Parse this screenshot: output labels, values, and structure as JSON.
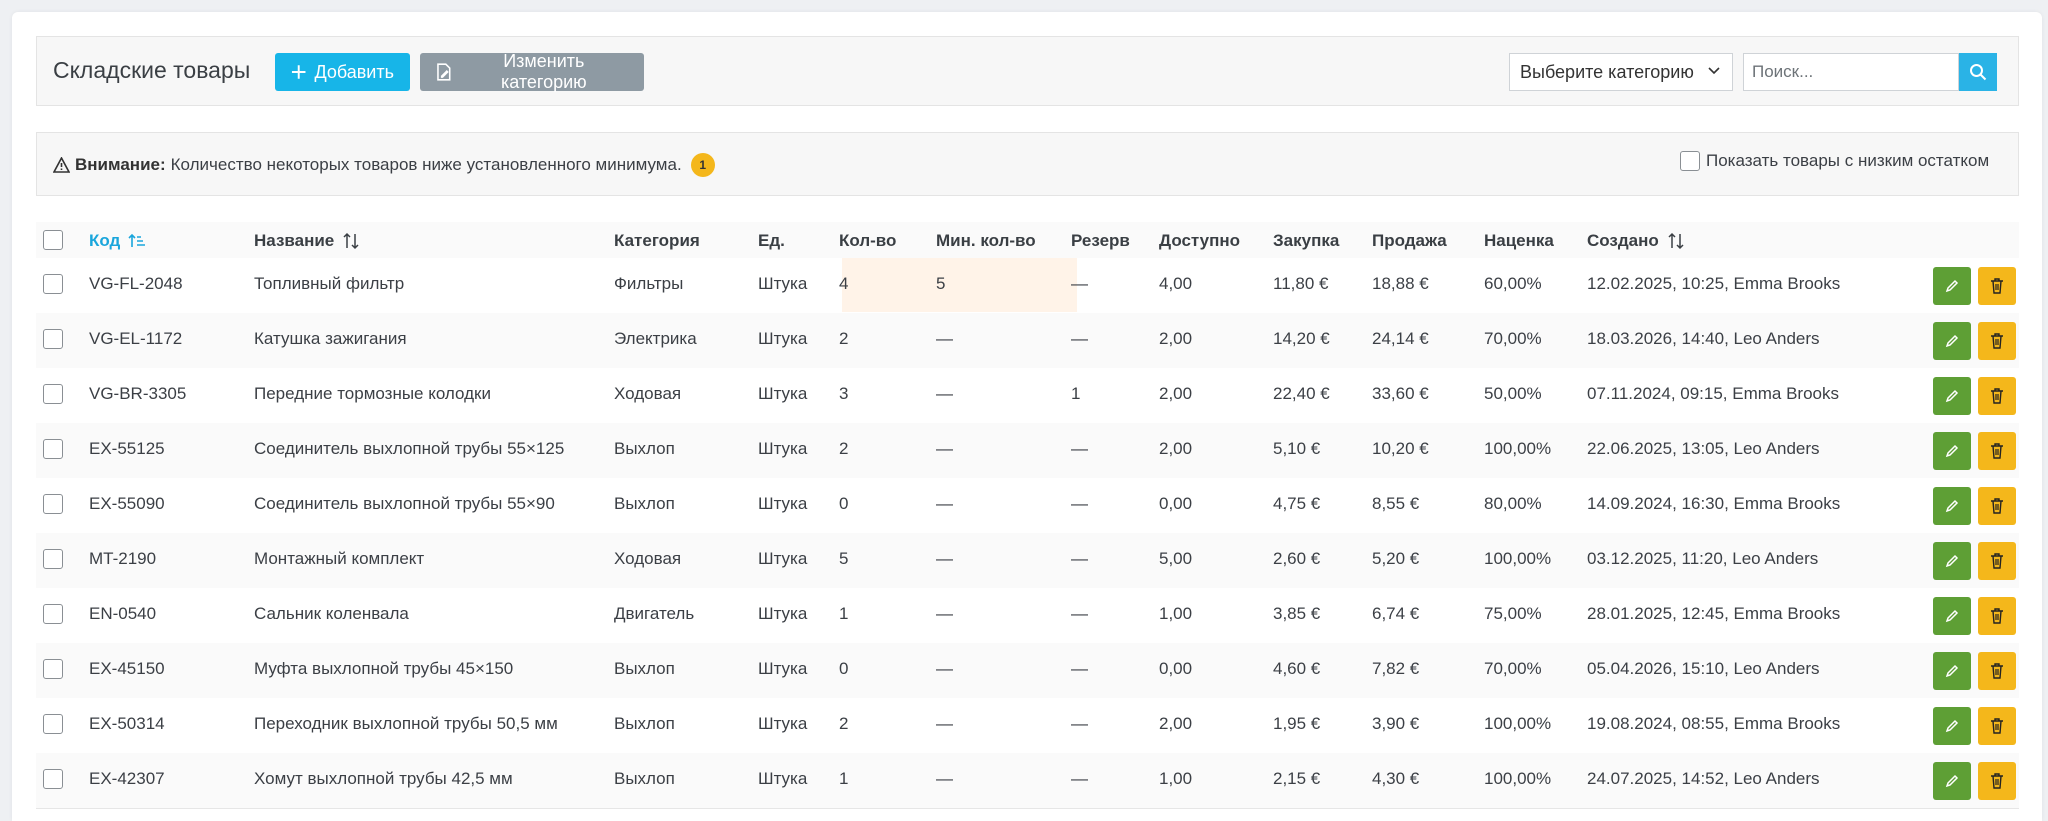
{
  "header": {
    "title": "Складские товары",
    "add_label": "Добавить",
    "change_category_label": "Изменить категорию",
    "category_select_value": "Выберите категорию",
    "search_placeholder": "Поиск..."
  },
  "alert": {
    "bold": "Внимание:",
    "message": "Количество некоторых товаров ниже установленного минимума.",
    "count": "1",
    "low_stock_label": "Показать товары с низким остатком"
  },
  "columns": {
    "code": "Код",
    "name": "Название",
    "category": "Категория",
    "unit": "Ед.",
    "qty": "Кол-во",
    "min_qty": "Мин. кол-во",
    "reserve": "Резерв",
    "available": "Доступно",
    "purchase": "Закупка",
    "sale": "Продажа",
    "markup": "Наценка",
    "created": "Создано"
  },
  "colors": {
    "accent": "#17b5e8",
    "edit": "#5e9f35",
    "delete": "#f4b71b",
    "low_stock_highlight": "#fff3e8"
  },
  "rows": [
    {
      "code": "VG-FL-2048",
      "name": "Топливный фильтр",
      "category": "Фильтры",
      "unit": "Штука",
      "qty": "4",
      "min_qty": "5",
      "reserve": "—",
      "available": "4,00",
      "purchase": "11,80 €",
      "sale": "18,88 €",
      "markup": "60,00%",
      "created": "12.02.2025, 10:25, Emma Brooks"
    },
    {
      "code": "VG-EL-1172",
      "name": "Катушка зажигания",
      "category": "Электрика",
      "unit": "Штука",
      "qty": "2",
      "min_qty": "—",
      "reserve": "—",
      "available": "2,00",
      "purchase": "14,20 €",
      "sale": "24,14 €",
      "markup": "70,00%",
      "created": "18.03.2026, 14:40, Leo Anders"
    },
    {
      "code": "VG-BR-3305",
      "name": "Передние тормозные колодки",
      "category": "Ходовая",
      "unit": "Штука",
      "qty": "3",
      "min_qty": "—",
      "reserve": "1",
      "available": "2,00",
      "purchase": "22,40 €",
      "sale": "33,60 €",
      "markup": "50,00%",
      "created": "07.11.2024, 09:15, Emma Brooks"
    },
    {
      "code": "EX-55125",
      "name": "Соединитель выхлопной трубы 55×125",
      "category": "Выхлоп",
      "unit": "Штука",
      "qty": "2",
      "min_qty": "—",
      "reserve": "—",
      "available": "2,00",
      "purchase": "5,10 €",
      "sale": "10,20 €",
      "markup": "100,00%",
      "created": "22.06.2025, 13:05, Leo Anders"
    },
    {
      "code": "EX-55090",
      "name": "Соединитель выхлопной трубы 55×90",
      "category": "Выхлоп",
      "unit": "Штука",
      "qty": "0",
      "min_qty": "—",
      "reserve": "—",
      "available": "0,00",
      "purchase": "4,75 €",
      "sale": "8,55 €",
      "markup": "80,00%",
      "created": "14.09.2024, 16:30, Emma Brooks"
    },
    {
      "code": "MT-2190",
      "name": "Монтажный комплект",
      "category": "Ходовая",
      "unit": "Штука",
      "qty": "5",
      "min_qty": "—",
      "reserve": "—",
      "available": "5,00",
      "purchase": "2,60 €",
      "sale": "5,20 €",
      "markup": "100,00%",
      "created": "03.12.2025, 11:20, Leo Anders"
    },
    {
      "code": "EN-0540",
      "name": "Сальник коленвала",
      "category": "Двигатель",
      "unit": "Штука",
      "qty": "1",
      "min_qty": "—",
      "reserve": "—",
      "available": "1,00",
      "purchase": "3,85 €",
      "sale": "6,74 €",
      "markup": "75,00%",
      "created": "28.01.2025, 12:45, Emma Brooks"
    },
    {
      "code": "EX-45150",
      "name": "Муфта выхлопной трубы 45×150",
      "category": "Выхлоп",
      "unit": "Штука",
      "qty": "0",
      "min_qty": "—",
      "reserve": "—",
      "available": "0,00",
      "purchase": "4,60 €",
      "sale": "7,82 €",
      "markup": "70,00%",
      "created": "05.04.2026, 15:10, Leo Anders"
    },
    {
      "code": "EX-50314",
      "name": "Переходник выхлопной трубы 50,5 мм",
      "category": "Выхлоп",
      "unit": "Штука",
      "qty": "2",
      "min_qty": "—",
      "reserve": "—",
      "available": "2,00",
      "purchase": "1,95 €",
      "sale": "3,90 €",
      "markup": "100,00%",
      "created": "19.08.2024, 08:55, Emma Brooks"
    },
    {
      "code": "EX-42307",
      "name": "Хомут выхлопной трубы 42,5 мм",
      "category": "Выхлоп",
      "unit": "Штука",
      "qty": "1",
      "min_qty": "—",
      "reserve": "—",
      "available": "1,00",
      "purchase": "2,15 €",
      "sale": "4,30 €",
      "markup": "100,00%",
      "created": "24.07.2025, 14:52, Leo Anders"
    }
  ]
}
